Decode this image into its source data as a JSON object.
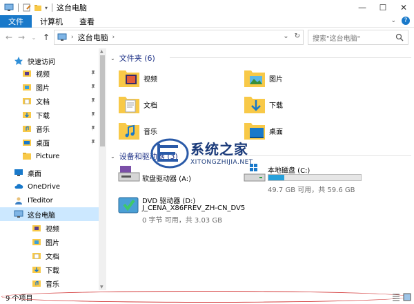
{
  "window": {
    "title": "这台电脑"
  },
  "ribbon": {
    "file_tab": "文件",
    "tabs": [
      "计算机",
      "查看"
    ]
  },
  "address": {
    "path": "这台电脑",
    "search_placeholder": "搜索\"这台电脑\""
  },
  "nav": {
    "quick_access": "快速访问",
    "quick_items": [
      "视频",
      "图片",
      "文档",
      "下载",
      "音乐",
      "桌面",
      "Picture"
    ],
    "desktop": "桌面",
    "onedrive": "OneDrive",
    "iteditor": "ITeditor",
    "this_pc": "这台电脑",
    "pc_children": [
      "视频",
      "图片",
      "文档",
      "下载",
      "音乐"
    ]
  },
  "content": {
    "folders_header": "文件夹 (6)",
    "folders": [
      "视频",
      "图片",
      "文档",
      "下载",
      "音乐",
      "桌面"
    ],
    "drives_header": "设备和驱动器 (3)",
    "drives": [
      {
        "name": "软盘驱动器 (A:)"
      },
      {
        "name": "本地磁盘 (C:)",
        "info": "49.7 GB 可用，共 59.6 GB",
        "used_fraction": 0.17
      },
      {
        "name": "DVD 驱动器 (D:)",
        "label": "J_CENA_X86FREV_ZH-CN_DV5",
        "info": "0 字节 可用，共 3.03 GB"
      }
    ]
  },
  "watermark": {
    "text": "系统之家",
    "sub": "XITONGZHIJIA.NET"
  },
  "status": {
    "items": "9 个项目"
  },
  "colors": {
    "accent": "#1979ca",
    "folder": "#f8c948",
    "section": "#1e3287",
    "selection": "#cce8ff"
  }
}
